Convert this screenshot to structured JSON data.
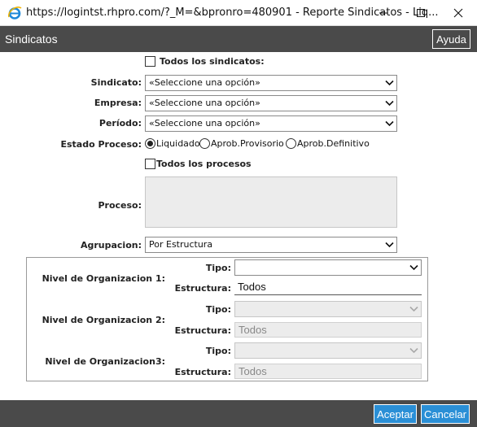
{
  "window": {
    "title": "https://logintst.rhpro.com/?_M=&bpronro=480901 - Reporte Sindicatos - Liq..."
  },
  "dialog": {
    "title": "Sindicatos",
    "help_label": "Ayuda"
  },
  "form": {
    "todos_sindicatos_label": "Todos los sindicatos:",
    "sindicato": {
      "label": "Sindicato:",
      "value": "«Seleccione una opción»"
    },
    "empresa": {
      "label": "Empresa:",
      "value": "«Seleccione una opción»"
    },
    "periodo": {
      "label": "Período:",
      "value": "«Seleccione una opción»"
    },
    "estado_proceso": {
      "label": "Estado Proceso:",
      "options": [
        "Liquidado",
        "Aprob.Provisorio",
        "Aprob.Definitivo"
      ],
      "selected": "Liquidado"
    },
    "todos_procesos_label": "Todos los procesos",
    "proceso_label": "Proceso:",
    "agrupacion": {
      "label": "Agrupacion:",
      "value": "Por Estructura"
    }
  },
  "niveles": [
    {
      "label": "Nivel de Organizacion 1:",
      "tipo_label": "Tipo:",
      "tipo_value": "",
      "estructura_label": "Estructura:",
      "estructura_value": "Todos"
    },
    {
      "label": "Nivel de Organizacion 2:",
      "tipo_label": "Tipo:",
      "tipo_value": "",
      "estructura_label": "Estructura:",
      "estructura_value": "Todos"
    },
    {
      "label": "Nivel de Organizacion3:",
      "tipo_label": "Tipo:",
      "tipo_value": "",
      "estructura_label": "Estructura:",
      "estructura_value": "Todos"
    }
  ],
  "footer": {
    "accept_label": "Aceptar",
    "cancel_label": "Cancelar"
  },
  "colors": {
    "header_bg": "#4a4a4a",
    "button_blue": "#2a8fd6",
    "disabled_bg": "#ececec"
  },
  "icons": {
    "browser": "internet-explorer-icon",
    "minimize": "minimize-icon",
    "maximize": "maximize-icon",
    "close": "close-icon",
    "dropdown": "chevron-down-icon"
  }
}
